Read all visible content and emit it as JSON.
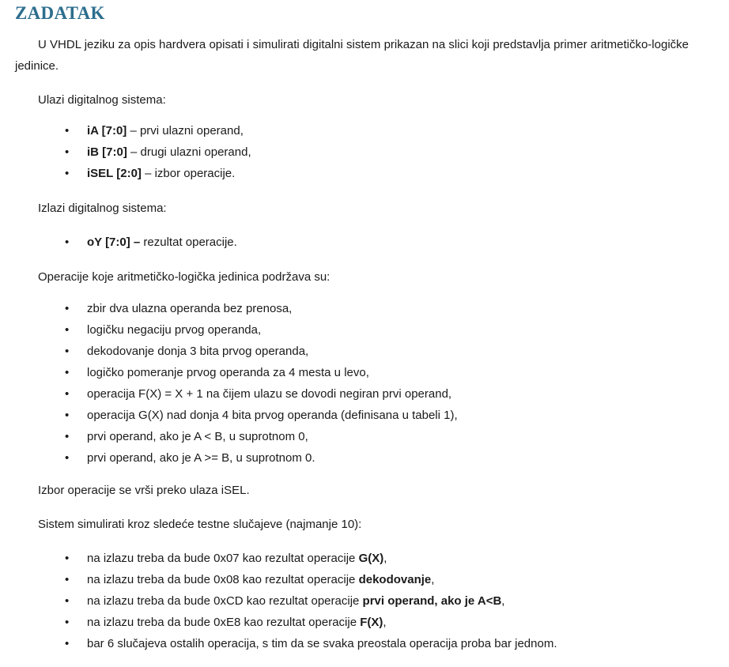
{
  "title": "ZADATAK",
  "intro": "U VHDL jeziku za opis hardvera opisati i simulirati digitalni sistem prikazan na slici koji predstavlja primer aritmetičko-logičke jedinice.",
  "inputs_heading": "Ulazi digitalnog sistema:",
  "inputs": [
    {
      "name": "iA [7:0]",
      "desc": " – prvi ulazni operand,"
    },
    {
      "name": "iB [7:0]",
      "desc": " – drugi ulazni operand,"
    },
    {
      "name": "iSEL [2:0]",
      "desc": " – izbor operacije."
    }
  ],
  "outputs_heading": "Izlazi digitalnog sistema:",
  "outputs": [
    {
      "name": "oY [7:0] –",
      "desc": " rezultat operacije."
    }
  ],
  "operations_heading": "Operacije koje aritmetičko-logička jedinica podržava su:",
  "operations": [
    "zbir dva ulazna operanda bez prenosa,",
    "logičku negaciju prvog operanda,",
    "dekodovanje donja 3 bita prvog operanda,",
    "logičko pomeranje prvog operanda za 4 mesta u levo,",
    "operacija F(X) = X + 1 na čijem ulazu se dovodi negiran prvi operand,",
    "operacija G(X) nad donja 4 bita prvog operanda (definisana u tabeli 1),",
    "prvi operand, ako je A < B, u suprotnom 0,",
    "prvi operand, ako je A >= B, u suprotnom 0."
  ],
  "selection_note": "Izbor operacije se vrši preko ulaza iSEL.",
  "tests_heading": "Sistem simulirati kroz sledeće testne slučajeve (najmanje 10):",
  "tests": [
    {
      "text": "na izlazu treba da bude 0x07 kao rezultat operacije ",
      "bold": "G(X)",
      "tail": ","
    },
    {
      "text": "na izlazu treba da bude 0x08 kao rezultat operacije ",
      "bold": "dekodovanje",
      "tail": ","
    },
    {
      "text": "na izlazu treba da bude 0xCD kao rezultat operacije ",
      "bold": "prvi operand, ako je A<B",
      "tail": ","
    },
    {
      "text": "na izlazu treba da bude 0xE8 kao rezultat operacije ",
      "bold": "F(X)",
      "tail": ","
    },
    {
      "text": "bar 6 slučajeva ostalih operacija, s tim da se svaka preostala operacija proba bar jednom.",
      "bold": "",
      "tail": ""
    }
  ],
  "bullet_glyph": "•"
}
